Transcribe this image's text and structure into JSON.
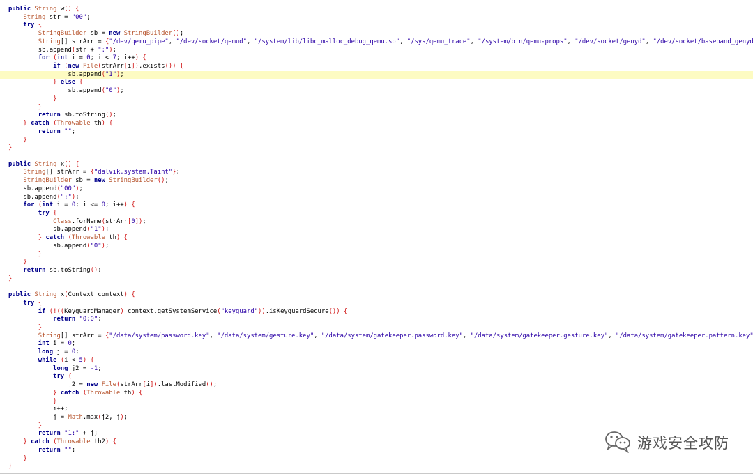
{
  "code": {
    "lines": [
      [
        [
          "kw",
          "public "
        ],
        [
          "ty",
          "String "
        ],
        [
          "pl",
          "w"
        ],
        [
          "bl",
          "() {"
        ]
      ],
      [
        [
          "pl",
          "    "
        ],
        [
          "ty",
          "String "
        ],
        [
          "pl",
          "str = "
        ],
        [
          "st",
          "\"00\""
        ],
        [
          "pl",
          ";"
        ]
      ],
      [
        [
          "pl",
          "    "
        ],
        [
          "kw",
          "try "
        ],
        [
          "bl",
          "{"
        ]
      ],
      [
        [
          "pl",
          "        "
        ],
        [
          "ty",
          "StringBuilder "
        ],
        [
          "pl",
          "sb = "
        ],
        [
          "kw",
          "new "
        ],
        [
          "ty",
          "StringBuilder"
        ],
        [
          "bl",
          "()"
        ],
        [
          "pl",
          ";"
        ]
      ],
      [
        [
          "pl",
          "        "
        ],
        [
          "ty",
          "String"
        ],
        [
          "pl",
          "[] strArr = "
        ],
        [
          "bl",
          "{"
        ],
        [
          "st",
          "\"/dev/qemu_pipe\""
        ],
        [
          "pl",
          ", "
        ],
        [
          "st",
          "\"/dev/socket/qemud\""
        ],
        [
          "pl",
          ", "
        ],
        [
          "st",
          "\"/system/lib/libc_malloc_debug_qemu.so\""
        ],
        [
          "pl",
          ", "
        ],
        [
          "st",
          "\"/sys/qemu_trace\""
        ],
        [
          "pl",
          ", "
        ],
        [
          "st",
          "\"/system/bin/qemu-props\""
        ],
        [
          "pl",
          ", "
        ],
        [
          "st",
          "\"/dev/socket/genyd\""
        ],
        [
          "pl",
          ", "
        ],
        [
          "st",
          "\"/dev/socket/baseband_genyd\""
        ],
        [
          "bl",
          "}"
        ],
        [
          "pl",
          ";"
        ]
      ],
      [
        [
          "pl",
          "        sb.append"
        ],
        [
          "bl",
          "("
        ],
        [
          "pl",
          "str + "
        ],
        [
          "st",
          "\":\""
        ],
        [
          "bl",
          ")"
        ],
        [
          "pl",
          ";"
        ]
      ],
      [
        [
          "pl",
          "        "
        ],
        [
          "kw",
          "for "
        ],
        [
          "bl",
          "("
        ],
        [
          "kw",
          "int "
        ],
        [
          "pl",
          "i = "
        ],
        [
          "nu",
          "0"
        ],
        [
          "pl",
          "; i < "
        ],
        [
          "nu",
          "7"
        ],
        [
          "pl",
          "; i++"
        ],
        [
          "bl",
          ") {"
        ]
      ],
      [
        [
          "pl",
          "            "
        ],
        [
          "kw",
          "if "
        ],
        [
          "bl",
          "("
        ],
        [
          "kw",
          "new "
        ],
        [
          "ty",
          "File"
        ],
        [
          "bl",
          "("
        ],
        [
          "pl",
          "strArr"
        ],
        [
          "bl",
          "["
        ],
        [
          "pl",
          "i"
        ],
        [
          "bl",
          "])"
        ],
        [
          "pl",
          ".exists"
        ],
        [
          "bl",
          "()) {"
        ]
      ],
      [
        [
          "pl",
          "                sb.append"
        ],
        [
          "bl",
          "("
        ],
        [
          "st",
          "\"1\""
        ],
        [
          "bl",
          ")"
        ],
        [
          "pl",
          ";"
        ]
      ],
      [
        [
          "pl",
          "            "
        ],
        [
          "bl",
          "} "
        ],
        [
          "kw",
          "else "
        ],
        [
          "bl",
          "{"
        ]
      ],
      [
        [
          "pl",
          "                sb.append"
        ],
        [
          "bl",
          "("
        ],
        [
          "st",
          "\"0\""
        ],
        [
          "bl",
          ")"
        ],
        [
          "pl",
          ";"
        ]
      ],
      [
        [
          "pl",
          "            "
        ],
        [
          "bl",
          "}"
        ]
      ],
      [
        [
          "pl",
          "        "
        ],
        [
          "bl",
          "}"
        ]
      ],
      [
        [
          "pl",
          "        "
        ],
        [
          "kw",
          "return "
        ],
        [
          "pl",
          "sb.toString"
        ],
        [
          "bl",
          "()"
        ],
        [
          "pl",
          ";"
        ]
      ],
      [
        [
          "pl",
          "    "
        ],
        [
          "bl",
          "} "
        ],
        [
          "kw",
          "catch "
        ],
        [
          "bl",
          "("
        ],
        [
          "ty",
          "Throwable "
        ],
        [
          "pl",
          "th"
        ],
        [
          "bl",
          ") {"
        ]
      ],
      [
        [
          "pl",
          "        "
        ],
        [
          "kw",
          "return "
        ],
        [
          "st",
          "\"\""
        ],
        [
          "pl",
          ";"
        ]
      ],
      [
        [
          "pl",
          "    "
        ],
        [
          "bl",
          "}"
        ]
      ],
      [
        [
          "bl",
          "}"
        ]
      ],
      [],
      [
        [
          "kw",
          "public "
        ],
        [
          "ty",
          "String "
        ],
        [
          "pl",
          "x"
        ],
        [
          "bl",
          "() {"
        ]
      ],
      [
        [
          "pl",
          "    "
        ],
        [
          "ty",
          "String"
        ],
        [
          "pl",
          "[] strArr = "
        ],
        [
          "bl",
          "{"
        ],
        [
          "st",
          "\"dalvik.system.Taint\""
        ],
        [
          "bl",
          "}"
        ],
        [
          "pl",
          ";"
        ]
      ],
      [
        [
          "pl",
          "    "
        ],
        [
          "ty",
          "StringBuilder "
        ],
        [
          "pl",
          "sb = "
        ],
        [
          "kw",
          "new "
        ],
        [
          "ty",
          "StringBuilder"
        ],
        [
          "bl",
          "()"
        ],
        [
          "pl",
          ";"
        ]
      ],
      [
        [
          "pl",
          "    sb.append"
        ],
        [
          "bl",
          "("
        ],
        [
          "st",
          "\"00\""
        ],
        [
          "bl",
          ")"
        ],
        [
          "pl",
          ";"
        ]
      ],
      [
        [
          "pl",
          "    sb.append"
        ],
        [
          "bl",
          "("
        ],
        [
          "st",
          "\":\""
        ],
        [
          "bl",
          ")"
        ],
        [
          "pl",
          ";"
        ]
      ],
      [
        [
          "pl",
          "    "
        ],
        [
          "kw",
          "for "
        ],
        [
          "bl",
          "("
        ],
        [
          "kw",
          "int "
        ],
        [
          "pl",
          "i = "
        ],
        [
          "nu",
          "0"
        ],
        [
          "pl",
          "; i <= "
        ],
        [
          "nu",
          "0"
        ],
        [
          "pl",
          "; i++"
        ],
        [
          "bl",
          ") {"
        ]
      ],
      [
        [
          "pl",
          "        "
        ],
        [
          "kw",
          "try "
        ],
        [
          "bl",
          "{"
        ]
      ],
      [
        [
          "pl",
          "            "
        ],
        [
          "ty",
          "Class"
        ],
        [
          "pl",
          ".forName"
        ],
        [
          "bl",
          "("
        ],
        [
          "pl",
          "strArr"
        ],
        [
          "bl",
          "["
        ],
        [
          "nu",
          "0"
        ],
        [
          "bl",
          "])"
        ],
        [
          "pl",
          ";"
        ]
      ],
      [
        [
          "pl",
          "            sb.append"
        ],
        [
          "bl",
          "("
        ],
        [
          "st",
          "\"1\""
        ],
        [
          "bl",
          ")"
        ],
        [
          "pl",
          ";"
        ]
      ],
      [
        [
          "pl",
          "        "
        ],
        [
          "bl",
          "} "
        ],
        [
          "kw",
          "catch "
        ],
        [
          "bl",
          "("
        ],
        [
          "ty",
          "Throwable "
        ],
        [
          "pl",
          "th"
        ],
        [
          "bl",
          ") {"
        ]
      ],
      [
        [
          "pl",
          "            sb.append"
        ],
        [
          "bl",
          "("
        ],
        [
          "st",
          "\"0\""
        ],
        [
          "bl",
          ")"
        ],
        [
          "pl",
          ";"
        ]
      ],
      [
        [
          "pl",
          "        "
        ],
        [
          "bl",
          "}"
        ]
      ],
      [
        [
          "pl",
          "    "
        ],
        [
          "bl",
          "}"
        ]
      ],
      [
        [
          "pl",
          "    "
        ],
        [
          "kw",
          "return "
        ],
        [
          "pl",
          "sb.toString"
        ],
        [
          "bl",
          "()"
        ],
        [
          "pl",
          ";"
        ]
      ],
      [
        [
          "bl",
          "}"
        ]
      ],
      [],
      [
        [
          "kw",
          "public "
        ],
        [
          "ty",
          "String "
        ],
        [
          "pl",
          "x"
        ],
        [
          "bl",
          "("
        ],
        [
          "pl",
          "Context context"
        ],
        [
          "bl",
          ") {"
        ]
      ],
      [
        [
          "pl",
          "    "
        ],
        [
          "kw",
          "try "
        ],
        [
          "bl",
          "{"
        ]
      ],
      [
        [
          "pl",
          "        "
        ],
        [
          "kw",
          "if "
        ],
        [
          "bl",
          "(!(("
        ],
        [
          "pl",
          "KeyguardManager"
        ],
        [
          "bl",
          ") "
        ],
        [
          "pl",
          "context.getSystemService"
        ],
        [
          "bl",
          "("
        ],
        [
          "st",
          "\"keyguard\""
        ],
        [
          "bl",
          "))"
        ],
        [
          "pl",
          ".isKeyguardSecure"
        ],
        [
          "bl",
          "()) {"
        ]
      ],
      [
        [
          "pl",
          "            "
        ],
        [
          "kw",
          "return "
        ],
        [
          "st",
          "\"0:0\""
        ],
        [
          "pl",
          ";"
        ]
      ],
      [
        [
          "pl",
          "        "
        ],
        [
          "bl",
          "}"
        ]
      ],
      [
        [
          "pl",
          "        "
        ],
        [
          "ty",
          "String"
        ],
        [
          "pl",
          "[] strArr = "
        ],
        [
          "bl",
          "{"
        ],
        [
          "st",
          "\"/data/system/password.key\""
        ],
        [
          "pl",
          ", "
        ],
        [
          "st",
          "\"/data/system/gesture.key\""
        ],
        [
          "pl",
          ", "
        ],
        [
          "st",
          "\"/data/system/gatekeeper.password.key\""
        ],
        [
          "pl",
          ", "
        ],
        [
          "st",
          "\"/data/system/gatekeeper.gesture.key\""
        ],
        [
          "pl",
          ", "
        ],
        [
          "st",
          "\"/data/system/gatekeeper.pattern.key\""
        ],
        [
          "bl",
          "}"
        ],
        [
          "pl",
          ";"
        ]
      ],
      [
        [
          "pl",
          "        "
        ],
        [
          "kw",
          "int "
        ],
        [
          "pl",
          "i = "
        ],
        [
          "nu",
          "0"
        ],
        [
          "pl",
          ";"
        ]
      ],
      [
        [
          "pl",
          "        "
        ],
        [
          "kw",
          "long "
        ],
        [
          "pl",
          "j = "
        ],
        [
          "nu",
          "0"
        ],
        [
          "pl",
          ";"
        ]
      ],
      [
        [
          "pl",
          "        "
        ],
        [
          "kw",
          "while "
        ],
        [
          "bl",
          "("
        ],
        [
          "pl",
          "i < "
        ],
        [
          "nu",
          "5"
        ],
        [
          "bl",
          ") {"
        ]
      ],
      [
        [
          "pl",
          "            "
        ],
        [
          "kw",
          "long "
        ],
        [
          "pl",
          "j2 = "
        ],
        [
          "nu",
          "-1"
        ],
        [
          "pl",
          ";"
        ]
      ],
      [
        [
          "pl",
          "            "
        ],
        [
          "kw",
          "try "
        ],
        [
          "bl",
          "{"
        ]
      ],
      [
        [
          "pl",
          "                j2 = "
        ],
        [
          "kw",
          "new "
        ],
        [
          "ty",
          "File"
        ],
        [
          "bl",
          "("
        ],
        [
          "pl",
          "strArr"
        ],
        [
          "bl",
          "["
        ],
        [
          "pl",
          "i"
        ],
        [
          "bl",
          "])"
        ],
        [
          "pl",
          ".lastModified"
        ],
        [
          "bl",
          "()"
        ],
        [
          "pl",
          ";"
        ]
      ],
      [
        [
          "pl",
          "            "
        ],
        [
          "bl",
          "} "
        ],
        [
          "kw",
          "catch "
        ],
        [
          "bl",
          "("
        ],
        [
          "ty",
          "Throwable "
        ],
        [
          "pl",
          "th"
        ],
        [
          "bl",
          ") {"
        ]
      ],
      [
        [
          "pl",
          "            "
        ],
        [
          "bl",
          "}"
        ]
      ],
      [
        [
          "pl",
          "            i++;"
        ]
      ],
      [
        [
          "pl",
          "            j = "
        ],
        [
          "ty",
          "Math"
        ],
        [
          "pl",
          ".max"
        ],
        [
          "bl",
          "("
        ],
        [
          "pl",
          "j2, j"
        ],
        [
          "bl",
          ")"
        ],
        [
          "pl",
          ";"
        ]
      ],
      [
        [
          "pl",
          "        "
        ],
        [
          "bl",
          "}"
        ]
      ],
      [
        [
          "pl",
          "        "
        ],
        [
          "kw",
          "return "
        ],
        [
          "st",
          "\"1:\""
        ],
        [
          "pl",
          " + j;"
        ]
      ],
      [
        [
          "pl",
          "    "
        ],
        [
          "bl",
          "} "
        ],
        [
          "kw",
          "catch "
        ],
        [
          "bl",
          "("
        ],
        [
          "ty",
          "Throwable "
        ],
        [
          "pl",
          "th2"
        ],
        [
          "bl",
          ") {"
        ]
      ],
      [
        [
          "pl",
          "        "
        ],
        [
          "kw",
          "return "
        ],
        [
          "st",
          "\"\""
        ],
        [
          "pl",
          ";"
        ]
      ],
      [
        [
          "pl",
          "    "
        ],
        [
          "bl",
          "}"
        ]
      ],
      [
        [
          "bl",
          "}"
        ]
      ]
    ],
    "highlighted_line": 8
  },
  "watermark": {
    "text": "游戏安全攻防",
    "icon": "wechat-icon"
  },
  "colors": {
    "keyword": "#00008b",
    "type": "#b6532c",
    "string": "#2a00a6",
    "bracket": "#d01111",
    "highlight": "#fdfbc2"
  }
}
